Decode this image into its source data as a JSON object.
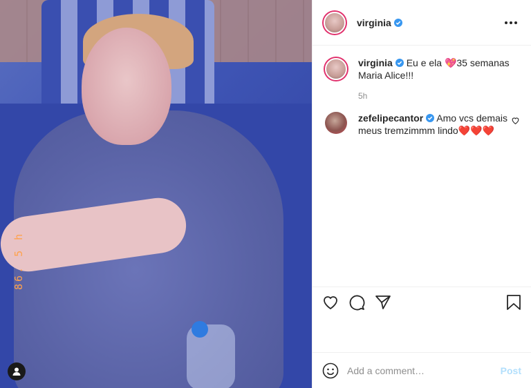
{
  "header": {
    "username": "virginia",
    "verified": true
  },
  "caption": {
    "username": "virginia",
    "text_before_emoji": "Eu e ela",
    "emoji": "💖",
    "text_after_emoji": "35 semanas Maria Alice!!!",
    "time": "5h"
  },
  "comments": [
    {
      "username": "zefelipecantor",
      "verified": true,
      "text": "Amo vcs demais meus tremzimmm lindo",
      "emoji": "❤️❤️❤️"
    }
  ],
  "media": {
    "stamp_text": "86. 5 h"
  },
  "add_comment": {
    "placeholder": "Add a comment…",
    "post_label": "Post"
  },
  "colors": {
    "verified_blue": "#3897f0",
    "post_disabled": "#b2dffc",
    "text": "#262626",
    "meta": "#8e8e8e"
  },
  "icons": [
    "verified-icon",
    "more-icon",
    "heart-icon",
    "comment-icon",
    "share-icon",
    "bookmark-icon",
    "emoji-icon",
    "user-icon"
  ]
}
